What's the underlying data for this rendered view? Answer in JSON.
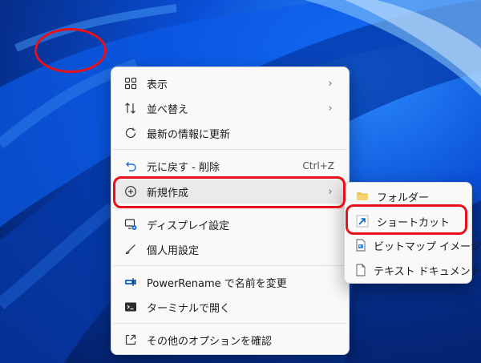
{
  "context_menu": {
    "items": [
      {
        "label": "表示",
        "icon": "grid-view-icon",
        "submenu": true
      },
      {
        "label": "並べ替え",
        "icon": "sort-icon",
        "submenu": true
      },
      {
        "label": "最新の情報に更新",
        "icon": "refresh-icon"
      },
      {
        "label": "元に戻す - 削除",
        "icon": "undo-icon",
        "shortcut": "Ctrl+Z"
      },
      {
        "label": "新規作成",
        "icon": "new-plus-icon",
        "submenu": true,
        "highlighted": true
      },
      {
        "label": "ディスプレイ設定",
        "icon": "display-settings-icon"
      },
      {
        "label": "個人用設定",
        "icon": "personalize-brush-icon"
      },
      {
        "label": "PowerRename で名前を変更",
        "icon": "powerrename-icon"
      },
      {
        "label": "ターミナルで開く",
        "icon": "terminal-icon"
      },
      {
        "label": "その他のオプションを確認",
        "icon": "more-options-icon"
      }
    ]
  },
  "submenu_new": {
    "items": [
      {
        "label": "フォルダー",
        "icon": "folder-icon"
      },
      {
        "label": "ショートカット",
        "icon": "shortcut-arrow-icon",
        "highlighted": true
      },
      {
        "label": "ビットマップ イメージ",
        "icon": "bitmap-image-icon"
      },
      {
        "label": "テキスト ドキュメント",
        "icon": "text-document-icon"
      }
    ]
  },
  "colors": {
    "annotation_red": "#e8101a",
    "accent_blue": "#0067c0",
    "folder_yellow": "#f2c14e"
  }
}
